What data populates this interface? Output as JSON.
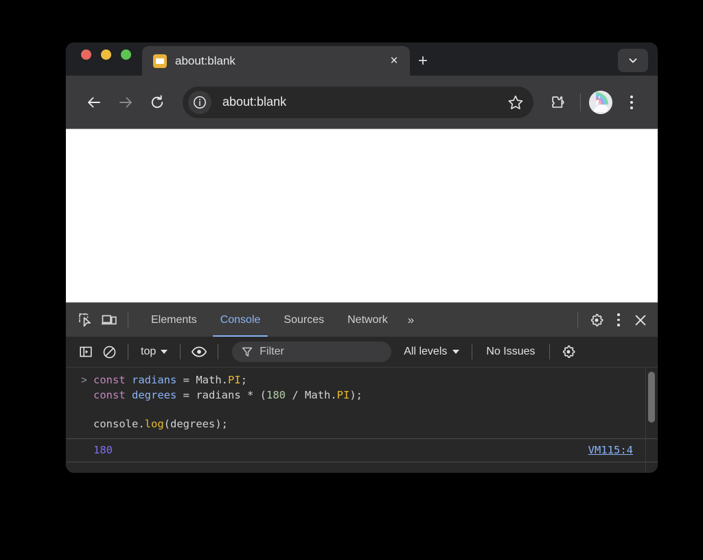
{
  "window": {
    "traffic_lights": [
      "close",
      "minimize",
      "maximize"
    ],
    "colors": {
      "close": "#e8685f",
      "minimize": "#f0bc40",
      "maximize": "#5dc454",
      "favicon": "#e8b33a",
      "accent_blue": "#8ab4f8",
      "output_purple": "#7c6ff0",
      "chrome_dark": "#3b3b3d",
      "devtools_bg": "#282828",
      "devtools_tabbar": "#3c3c3c"
    }
  },
  "tabstrip": {
    "tab_title": "about:blank",
    "tab_close_label": "×",
    "new_tab_label": "+",
    "tab_search_label": "tab-search"
  },
  "toolbar": {
    "back_label": "Back",
    "forward_label": "Forward",
    "reload_label": "Reload",
    "url": "about:blank",
    "site_info_label": "View site information",
    "bookmark_label": "Bookmark this tab",
    "extensions_label": "Extensions",
    "profile_label": "Profile",
    "menu_label": "Customize and control"
  },
  "devtools": {
    "inspect_label": "Inspect element",
    "device_toolbar_label": "Toggle device toolbar",
    "panels": [
      {
        "label": "Elements",
        "active": false
      },
      {
        "label": "Console",
        "active": true
      },
      {
        "label": "Sources",
        "active": false
      },
      {
        "label": "Network",
        "active": false
      }
    ],
    "more_panels_label": "»",
    "settings_label": "Settings",
    "more_options_label": "More options",
    "close_label": "×"
  },
  "console_toolbar": {
    "sidebar_label": "Show console sidebar",
    "clear_label": "Clear console",
    "context": "top",
    "live_expression_label": "Create live expression",
    "filter_placeholder": "Filter",
    "levels": "All levels",
    "issues": "No Issues",
    "settings_label": "Console settings"
  },
  "console": {
    "prompt_symbol": ">",
    "input_lines": [
      {
        "tokens": [
          {
            "t": "const",
            "c": "kw"
          },
          {
            "t": " ",
            "c": "punc"
          },
          {
            "t": "radians",
            "c": "var"
          },
          {
            "t": " = ",
            "c": "punc"
          },
          {
            "t": "Math",
            "c": "obj"
          },
          {
            "t": ".",
            "c": "punc"
          },
          {
            "t": "PI",
            "c": "prop"
          },
          {
            "t": ";",
            "c": "punc"
          }
        ]
      },
      {
        "tokens": [
          {
            "t": "const",
            "c": "kw"
          },
          {
            "t": " ",
            "c": "punc"
          },
          {
            "t": "degrees",
            "c": "var"
          },
          {
            "t": " = ",
            "c": "punc"
          },
          {
            "t": "radians",
            "c": "obj"
          },
          {
            "t": " * (",
            "c": "punc"
          },
          {
            "t": "180",
            "c": "num"
          },
          {
            "t": " / ",
            "c": "punc"
          },
          {
            "t": "Math",
            "c": "obj"
          },
          {
            "t": ".",
            "c": "punc"
          },
          {
            "t": "PI",
            "c": "prop"
          },
          {
            "t": ");",
            "c": "punc"
          }
        ]
      },
      {
        "tokens": []
      },
      {
        "tokens": [
          {
            "t": "console",
            "c": "obj"
          },
          {
            "t": ".",
            "c": "punc"
          },
          {
            "t": "log",
            "c": "prop"
          },
          {
            "t": "(",
            "c": "punc"
          },
          {
            "t": "degrees",
            "c": "obj"
          },
          {
            "t": ");",
            "c": "punc"
          }
        ]
      }
    ],
    "output_value": "180",
    "output_source": "VM115:4"
  }
}
